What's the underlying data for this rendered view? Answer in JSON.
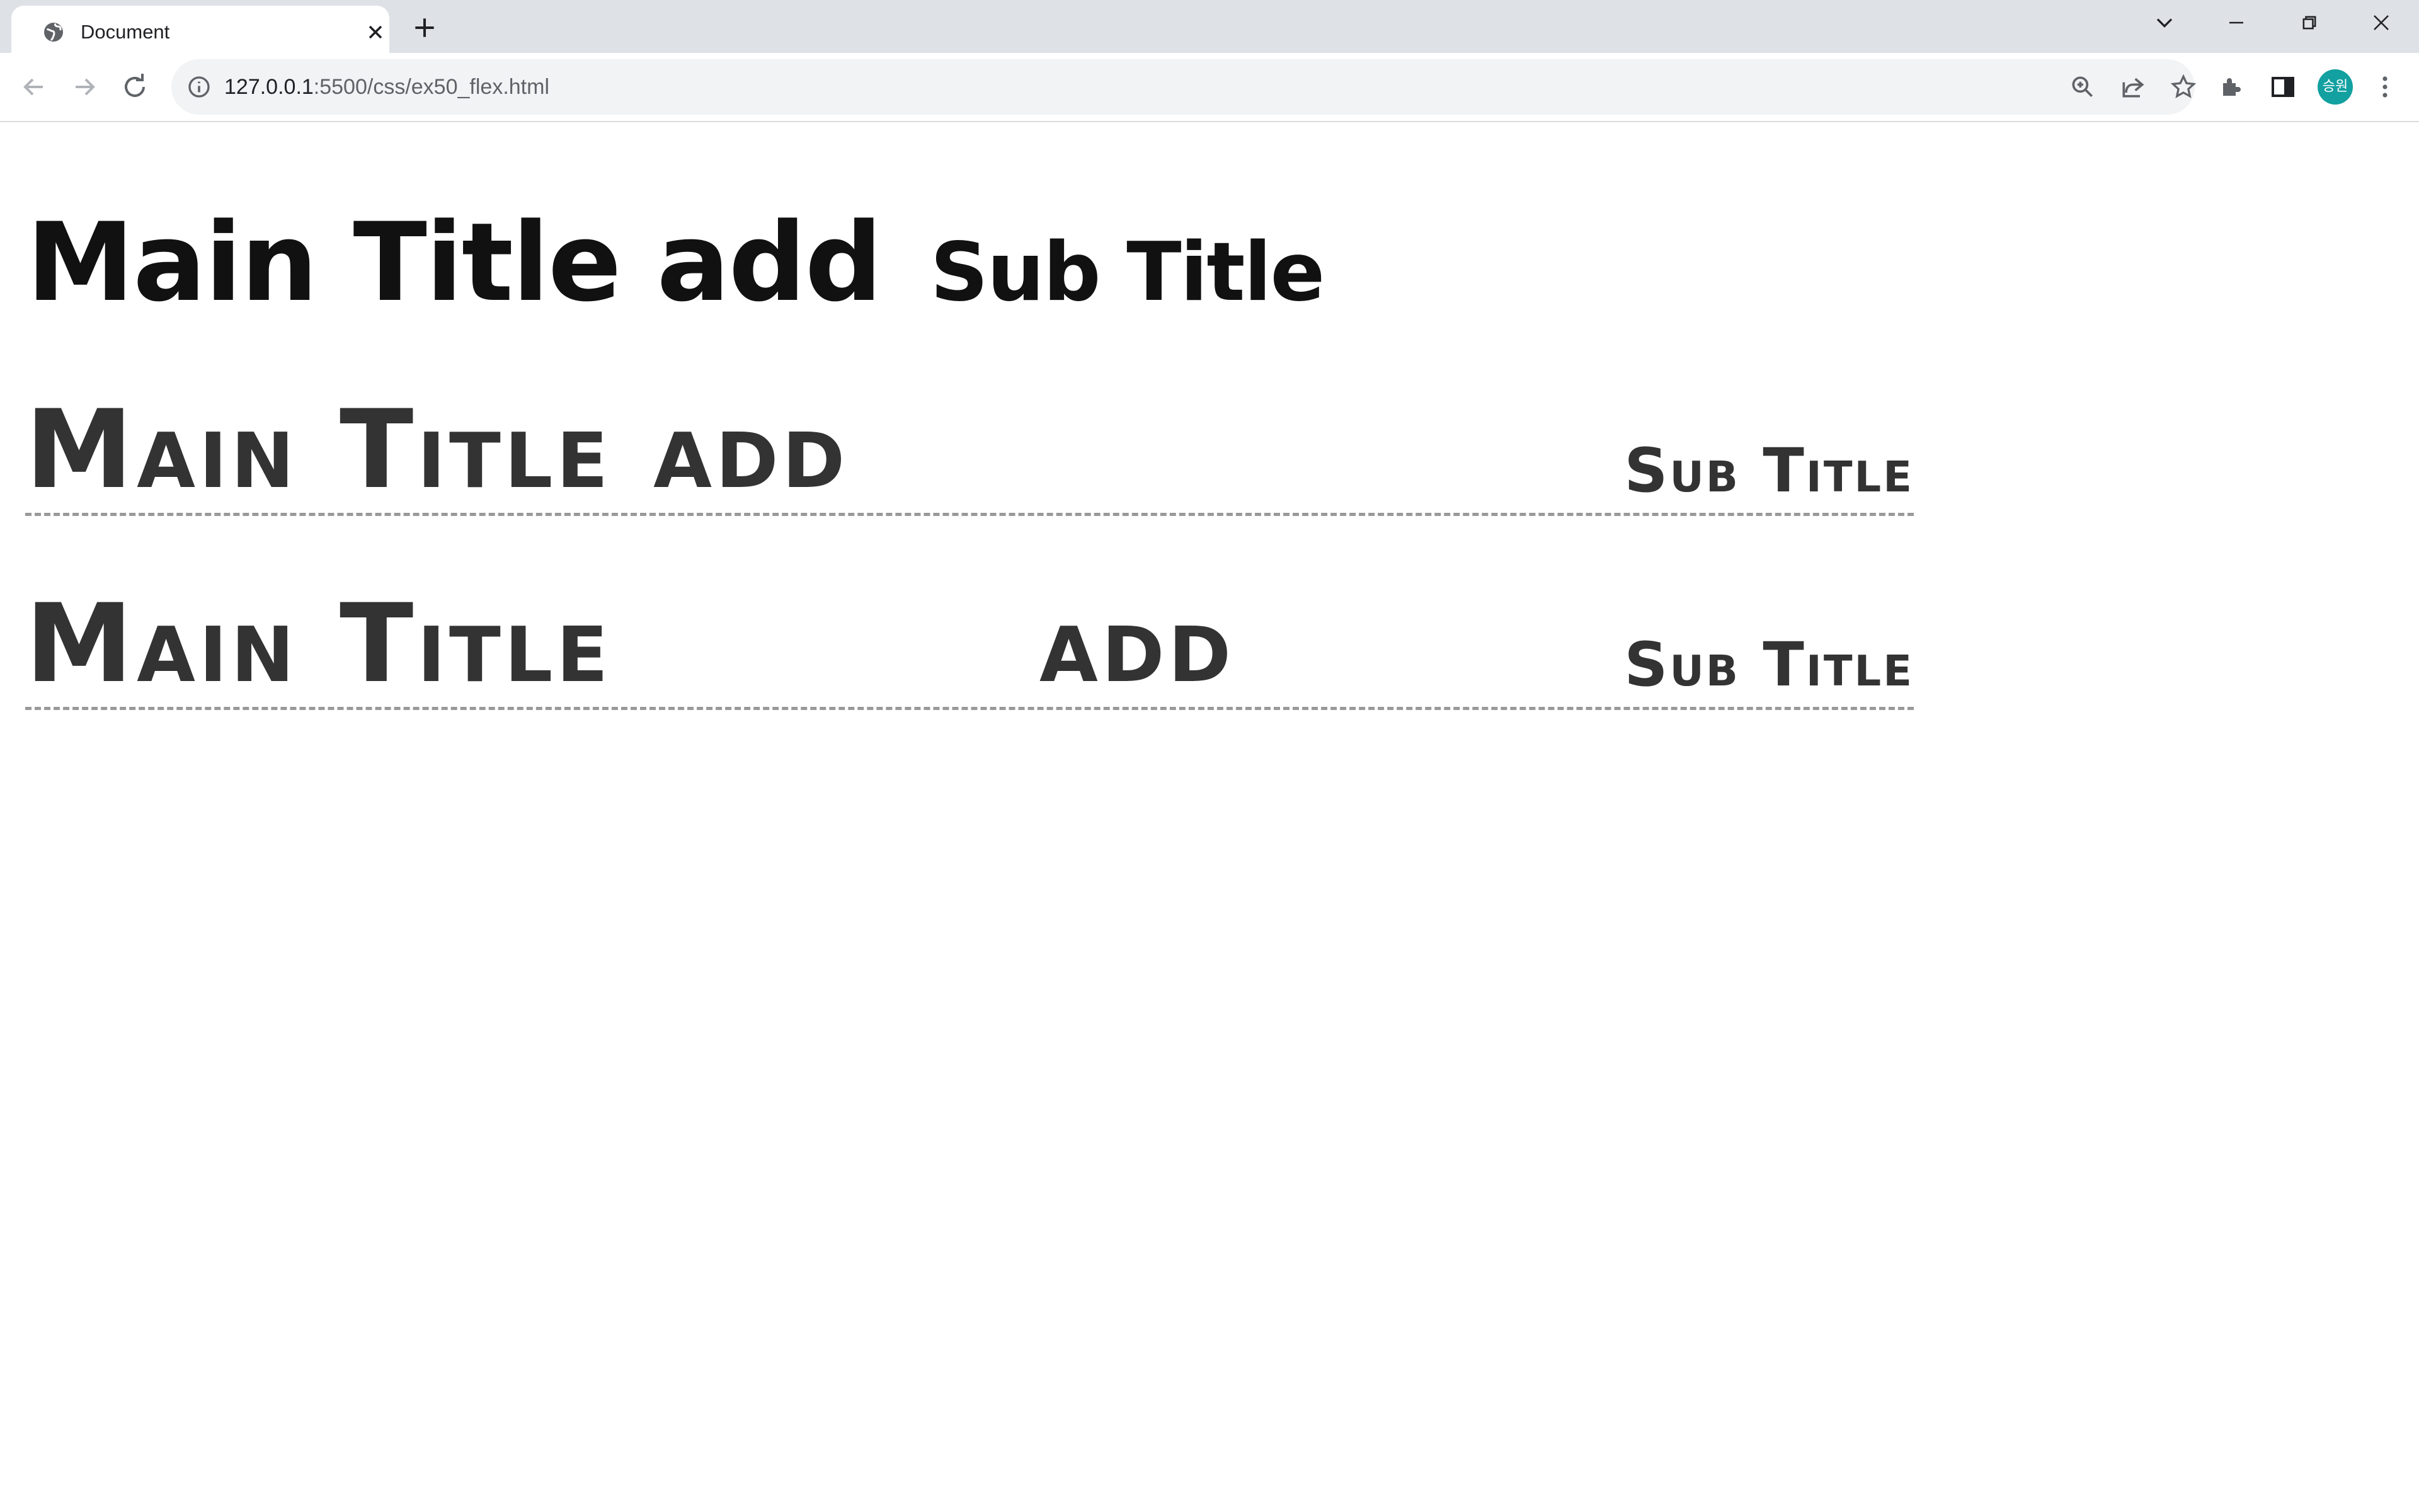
{
  "browser": {
    "tab_title": "Document",
    "url_host": "127.0.0.1",
    "url_path": ":5500/css/ex50_flex.html",
    "avatar_text": "승원",
    "icons": {
      "favicon": "globe-icon",
      "tab_close": "close-icon",
      "new_tab": "plus-icon",
      "tab_search": "chevron-down-icon",
      "minimize": "minimize-icon",
      "restore": "restore-icon",
      "close_window": "close-icon",
      "back": "arrow-left-icon",
      "forward": "arrow-right-icon",
      "reload": "reload-icon",
      "site_info": "info-icon",
      "zoom": "zoom-icon",
      "share": "share-icon",
      "bookmark": "star-icon",
      "extensions": "puzzle-icon",
      "side_panel": "side-panel-icon",
      "menu": "kebab-menu-icon"
    }
  },
  "page": {
    "heading": {
      "main": "Main Title add",
      "sub": "Sub Title"
    },
    "row1": {
      "main": "Main Title add",
      "sub": "Sub Title"
    },
    "row2": {
      "main": "Main Title",
      "add": "add",
      "sub": "Sub Title"
    }
  }
}
